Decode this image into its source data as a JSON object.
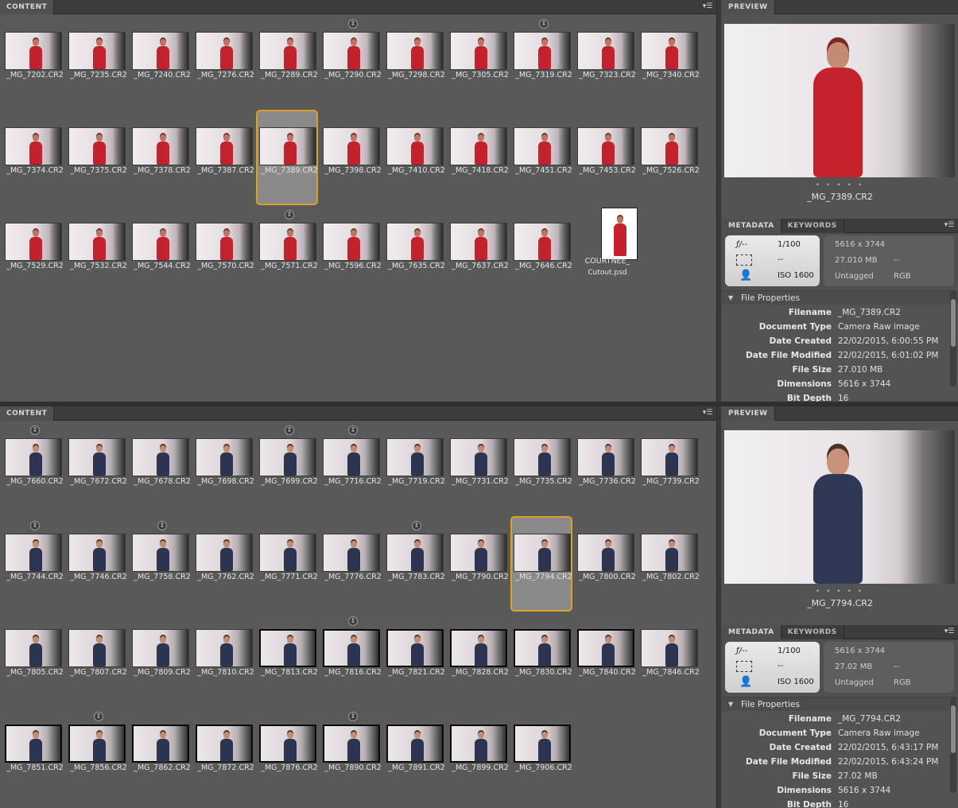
{
  "panels": [
    {
      "content_tab": "CONTENT",
      "preview_tab": "PREVIEW",
      "subject": "woman",
      "thumbnails": [
        {
          "name": "_MG_7202.CR2"
        },
        {
          "name": "_MG_7235.CR2"
        },
        {
          "name": "_MG_7240.CR2"
        },
        {
          "name": "_MG_7276.CR2"
        },
        {
          "name": "_MG_7289.CR2"
        },
        {
          "name": "_MG_7290.CR2",
          "stack": true
        },
        {
          "name": "_MG_7298.CR2"
        },
        {
          "name": "_MG_7305.CR2"
        },
        {
          "name": "_MG_7319.CR2",
          "stack": true
        },
        {
          "name": "_MG_7323.CR2"
        },
        {
          "name": "_MG_7340.CR2"
        },
        {
          "name": "_MG_7374.CR2"
        },
        {
          "name": "_MG_7375.CR2"
        },
        {
          "name": "_MG_7378.CR2"
        },
        {
          "name": "_MG_7387.CR2"
        },
        {
          "name": "_MG_7389.CR2",
          "selected": true
        },
        {
          "name": "_MG_7398.CR2"
        },
        {
          "name": "_MG_7410.CR2"
        },
        {
          "name": "_MG_7418.CR2"
        },
        {
          "name": "_MG_7451.CR2"
        },
        {
          "name": "_MG_7453.CR2"
        },
        {
          "name": "_MG_7526.CR2"
        },
        {
          "name": "_MG_7529.CR2"
        },
        {
          "name": "_MG_7532.CR2"
        },
        {
          "name": "_MG_7544.CR2"
        },
        {
          "name": "_MG_7570.CR2"
        },
        {
          "name": "_MG_7571.CR2",
          "stack": true
        },
        {
          "name": "_MG_7596.CR2"
        },
        {
          "name": "_MG_7635.CR2"
        },
        {
          "name": "_MG_7637.CR2"
        },
        {
          "name": "_MG_7646.CR2"
        },
        {
          "name": "COURTNEE_",
          "name2": "Cutout.psd",
          "portrait": true
        }
      ],
      "preview_name": "_MG_7389.CR2",
      "metadata_tab": "METADATA",
      "keywords_tab": "KEYWORDS",
      "summary": {
        "aperture": "ƒ/--",
        "shutter": "1/100",
        "metering": "--",
        "iso": "ISO 1600",
        "dimensions": "5616 x 3744",
        "size": "27.010 MB",
        "resolution": "--",
        "label": "Untagged",
        "color_mode": "RGB"
      },
      "file_properties_label": "File Properties",
      "properties": [
        {
          "k": "Filename",
          "v": "_MG_7389.CR2"
        },
        {
          "k": "Document Type",
          "v": "Camera Raw image"
        },
        {
          "k": "Date Created",
          "v": "22/02/2015, 6:00:55 PM"
        },
        {
          "k": "Date File Modified",
          "v": "22/02/2015, 6:01:02 PM"
        },
        {
          "k": "File Size",
          "v": "27.010 MB"
        },
        {
          "k": "Dimensions",
          "v": "5616 x 3744"
        },
        {
          "k": "Bit Depth",
          "v": "16"
        }
      ]
    },
    {
      "content_tab": "CONTENT",
      "preview_tab": "PREVIEW",
      "subject": "man",
      "thumbnails": [
        {
          "name": "_MG_7660.CR2",
          "stack": true
        },
        {
          "name": "_MG_7672.CR2"
        },
        {
          "name": "_MG_7678.CR2"
        },
        {
          "name": "_MG_7698.CR2"
        },
        {
          "name": "_MG_7699.CR2",
          "stack": true
        },
        {
          "name": "_MG_7716.CR2",
          "stack": true
        },
        {
          "name": "_MG_7719.CR2"
        },
        {
          "name": "_MG_7731.CR2"
        },
        {
          "name": "_MG_7735.CR2"
        },
        {
          "name": "_MG_7736.CR2"
        },
        {
          "name": "_MG_7739.CR2"
        },
        {
          "name": "_MG_7744.CR2",
          "stack": true
        },
        {
          "name": "_MG_7746.CR2"
        },
        {
          "name": "_MG_7758.CR2",
          "stack": true
        },
        {
          "name": "_MG_7762.CR2"
        },
        {
          "name": "_MG_7771.CR2"
        },
        {
          "name": "_MG_7776.CR2"
        },
        {
          "name": "_MG_7783.CR2",
          "stack": true
        },
        {
          "name": "_MG_7790.CR2"
        },
        {
          "name": "_MG_7794.CR2",
          "selected": true
        },
        {
          "name": "_MG_7800.CR2"
        },
        {
          "name": "_MG_7802.CR2"
        },
        {
          "name": "_MG_7805.CR2"
        },
        {
          "name": "_MG_7807.CR2"
        },
        {
          "name": "_MG_7809.CR2"
        },
        {
          "name": "_MG_7810.CR2"
        },
        {
          "name": "_MG_7813.CR2",
          "dark": true
        },
        {
          "name": "_MG_7816.CR2",
          "stack": true,
          "dark": true
        },
        {
          "name": "_MG_7821.CR2",
          "dark": true
        },
        {
          "name": "_MG_7828.CR2",
          "dark": true
        },
        {
          "name": "_MG_7830.CR2",
          "dark": true
        },
        {
          "name": "_MG_7840.CR2",
          "dark": true
        },
        {
          "name": "_MG_7846.CR2"
        },
        {
          "name": "_MG_7851.CR2",
          "dark": true
        },
        {
          "name": "_MG_7856.CR2",
          "stack": true,
          "dark": true
        },
        {
          "name": "_MG_7862.CR2",
          "dark": true
        },
        {
          "name": "_MG_7872.CR2",
          "dark": true
        },
        {
          "name": "_MG_7876.CR2",
          "dark": true
        },
        {
          "name": "_MG_7890.CR2",
          "stack": true,
          "dark": true
        },
        {
          "name": "_MG_7891.CR2",
          "dark": true
        },
        {
          "name": "_MG_7899.CR2",
          "dark": true
        },
        {
          "name": "_MG_7906.CR2",
          "dark": true
        }
      ],
      "preview_name": "_MG_7794.CR2",
      "metadata_tab": "METADATA",
      "keywords_tab": "KEYWORDS",
      "summary": {
        "aperture": "ƒ/--",
        "shutter": "1/100",
        "metering": "--",
        "iso": "ISO 1600",
        "dimensions": "5616 x 3744",
        "size": "27.02 MB",
        "resolution": "--",
        "label": "Untagged",
        "color_mode": "RGB"
      },
      "file_properties_label": "File Properties",
      "properties": [
        {
          "k": "Filename",
          "v": "_MG_7794.CR2"
        },
        {
          "k": "Document Type",
          "v": "Camera Raw image"
        },
        {
          "k": "Date Created",
          "v": "22/02/2015, 6:43:17 PM"
        },
        {
          "k": "Date File Modified",
          "v": "22/02/2015, 6:43:24 PM"
        },
        {
          "k": "File Size",
          "v": "27.02 MB"
        },
        {
          "k": "Dimensions",
          "v": "5616 x 3744"
        },
        {
          "k": "Bit Depth",
          "v": "16"
        }
      ]
    }
  ],
  "colors": {
    "selection": "#d9a128",
    "panel_bg": "#595959",
    "tab_bg": "#3c3c3c"
  },
  "icons": {
    "stack_badge": "stack-icon",
    "panel_menu": "panel-menu-icon",
    "metering": "metering-icon",
    "exposure_mode": "person-icon"
  }
}
